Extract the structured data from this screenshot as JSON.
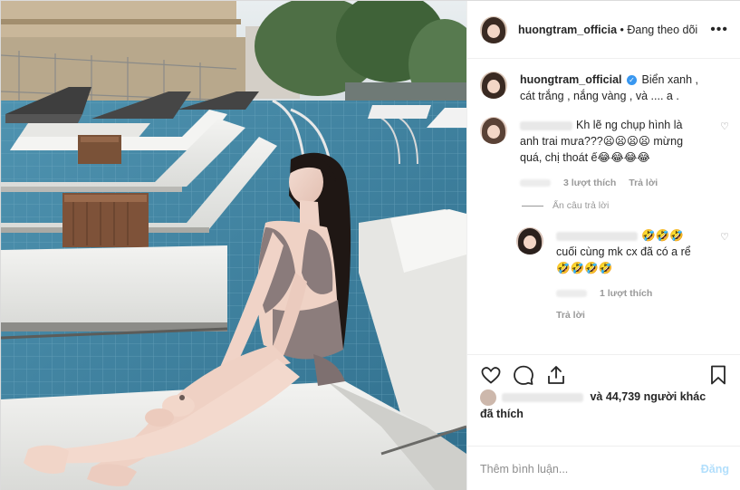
{
  "header": {
    "username": "huongtram_officia",
    "separator": " • ",
    "follow_status": "Đang theo dõi",
    "more_label": "•••"
  },
  "caption": {
    "username": "huongtram_official",
    "verified_mark": "✓",
    "text": "Biển xanh , cát trắng , nắng vàng , và .... a ."
  },
  "comments": [
    {
      "text": "Kh lẽ ng chụp hình là anh trai mưa???😦😦😦😦 mừng quá, chị thoát ế😂😂😂😂",
      "likes": "3 lượt thích",
      "reply_label": "Trả lời",
      "hide_replies": "Ẩn câu trả lời"
    },
    {
      "text": "🤣🤣🤣 cuối cùng mk cx đã có a rể🤣🤣🤣🤣",
      "likes": "1 lượt thích",
      "reply_label": "Trả lời"
    }
  ],
  "icons": {
    "heart": "heart-icon",
    "comment": "comment-icon",
    "share": "share-icon",
    "bookmark": "bookmark-icon"
  },
  "likes": {
    "count_text": "và 44,739 người khác",
    "suffix": "đã thích"
  },
  "add_comment": {
    "placeholder": "Thêm bình luận...",
    "post_label": "Đăng"
  },
  "colors": {
    "accent": "#3897f0",
    "post_disabled": "#b2dffc",
    "muted": "#8e8e8e"
  }
}
